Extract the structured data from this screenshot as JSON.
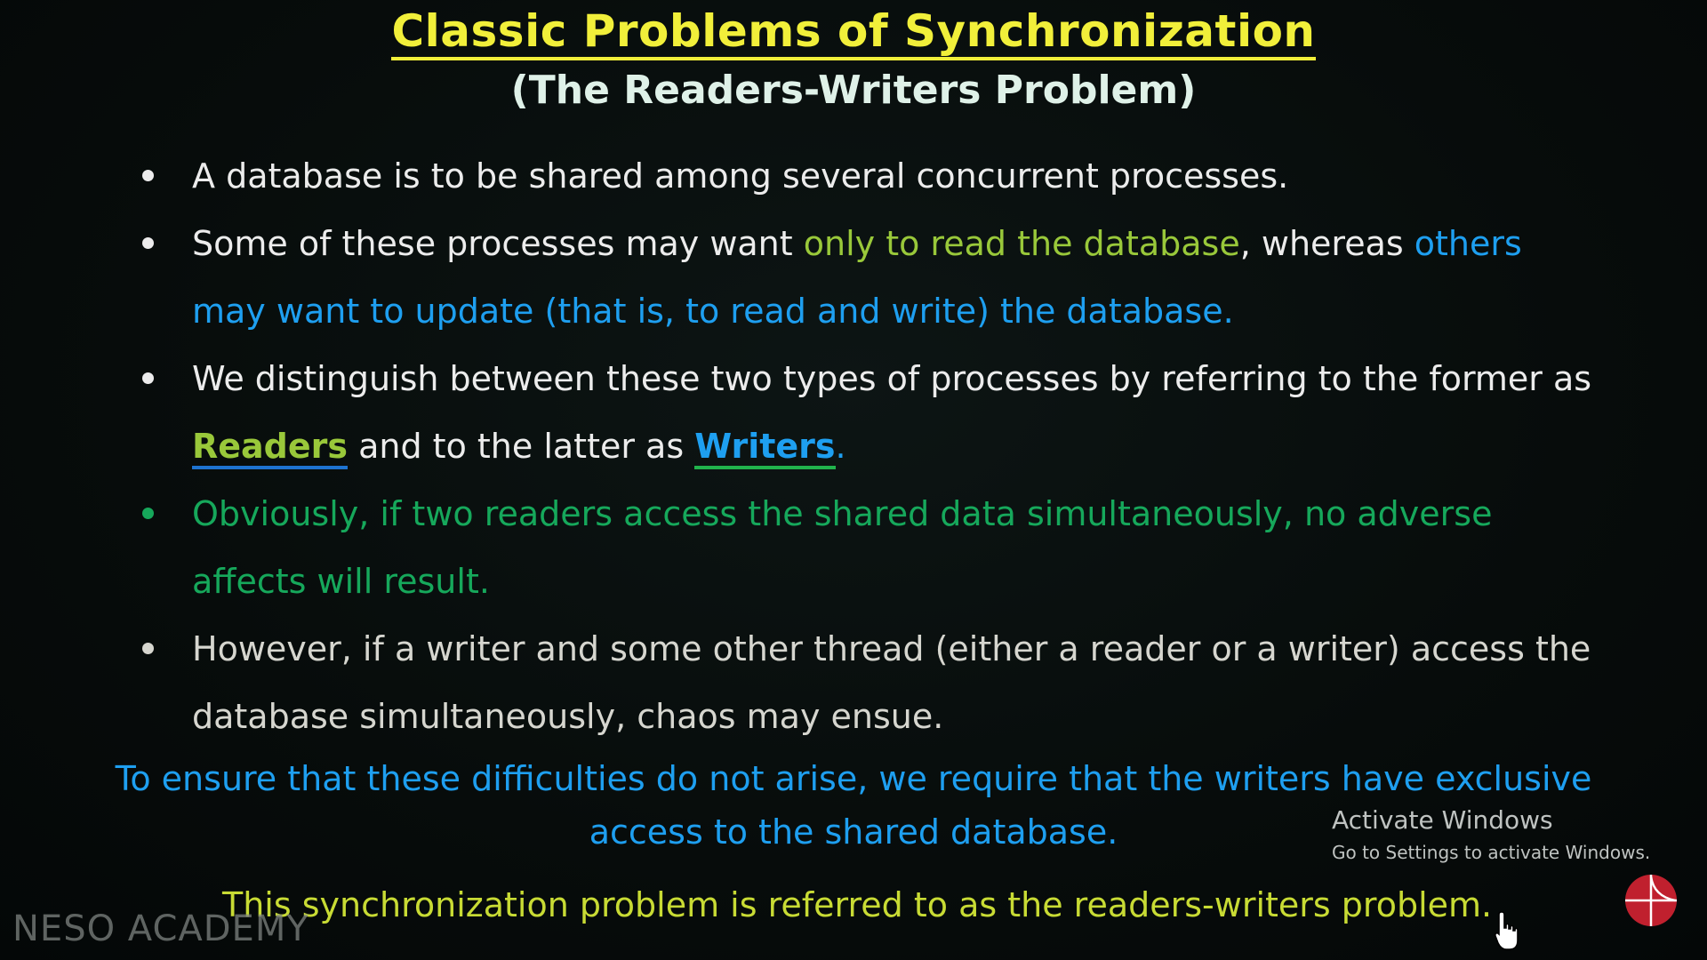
{
  "slide": {
    "title": "Classic Problems of Synchronization",
    "subtitle": "(The Readers-Writers Problem)",
    "bullets": {
      "b1": "A database is to be shared among several concurrent processes.",
      "b2_part1": "Some of these processes may want ",
      "b2_part2": "only to read the database",
      "b2_part3": ", whereas ",
      "b2_part4": "others may want to update (that is, to read and write) the database.",
      "b3_part1": "We distinguish between these two types of processes by referring to the former as ",
      "b3_readers": "Readers",
      "b3_part2": " and to the latter as ",
      "b3_writers": "Writers",
      "b3_period": ".",
      "b4": "Obviously, if two readers access the shared data simultaneously, no adverse affects will result.",
      "b5": "However, if a writer and some other thread (either a reader or a writer) access the database simultaneously, chaos may ensue."
    },
    "conclusion_line1": "To ensure that these difficulties do not arise, we require that the writers have exclusive",
    "conclusion_line2": "access to the shared database.",
    "final_line": "This synchronization problem is referred to as the readers-writers problem."
  },
  "overlay": {
    "watermark": "NESO ACADEMY",
    "activate_title": "Activate Windows",
    "activate_subtitle": "Go to Settings to activate Windows."
  },
  "colors": {
    "title": "#f1ef3a",
    "lime": "#99c83a",
    "blue": "#1e9ff0",
    "green": "#16a85b",
    "final": "#c8db34",
    "logo": "#c0202e"
  }
}
